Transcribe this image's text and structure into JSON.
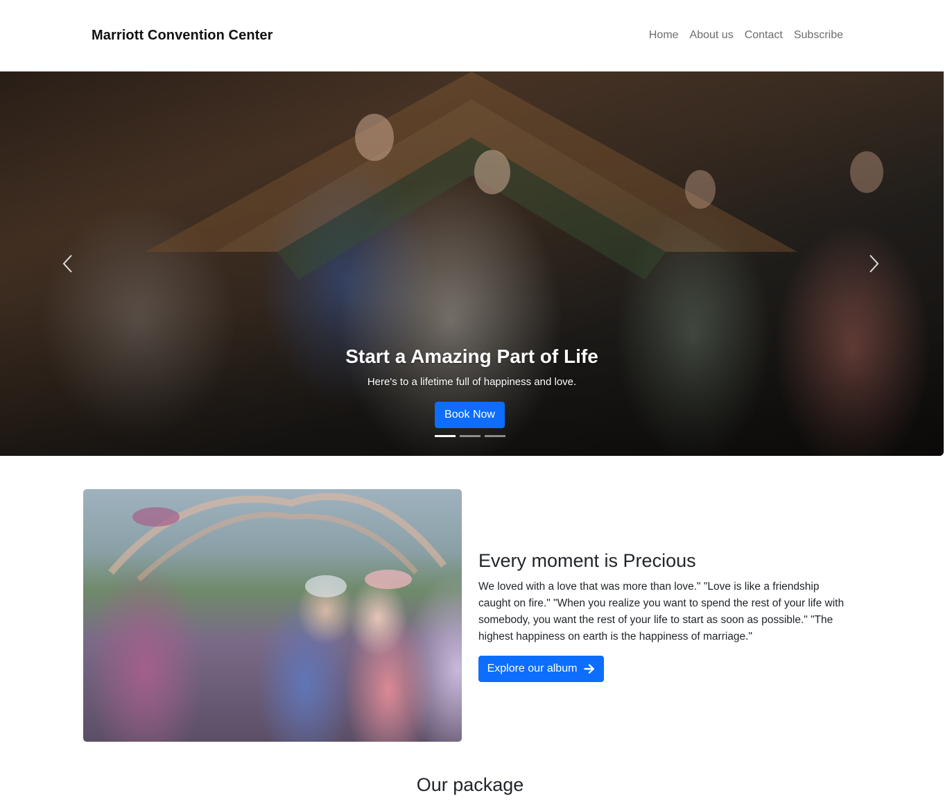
{
  "navbar": {
    "brand": "Marriott Convention Center",
    "links": [
      "Home",
      "About us",
      "Contact",
      "Subscribe"
    ]
  },
  "hero": {
    "title": "Start a Amazing Part of Life",
    "subtitle": "Here's to a lifetime full of happiness and love.",
    "button_label": "Book Now",
    "slide_count": 3,
    "active_slide": 1,
    "prev_icon": "chevron-left-icon",
    "next_icon": "chevron-right-icon"
  },
  "feature": {
    "title": "Every moment is Precious",
    "text": "We loved with a love that was more than love.\" \"Love is like a friendship caught on fire.\" \"When you realize you want to spend the rest of your life with somebody, you want the rest of your life to start as soon as possible.\" \"The highest happiness on earth is the happiness of marriage.\"",
    "button_label": "Explore our album",
    "button_icon": "arrow-right-icon"
  },
  "packages": {
    "title": "Our package"
  },
  "colors": {
    "primary": "#0d6efd",
    "nav_link": "#6c6c6c",
    "text": "#212529"
  }
}
